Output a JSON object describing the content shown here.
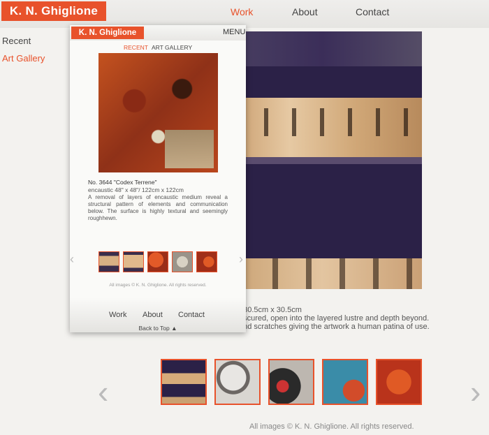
{
  "site": {
    "logo": "K. N. Ghiglione",
    "nav": [
      "Work",
      "About",
      "Contact"
    ]
  },
  "sidebar": {
    "items": [
      "Recent",
      "Art Gallery"
    ]
  },
  "main": {
    "size_text": "/ 30.5cm x 30.5cm",
    "desc_line1": "bscured, open into the layered lustre and depth beyond.",
    "desc_line2": "and scratches giving the artwork a human patina of use.",
    "thumb_count": 5,
    "prev_icon": "‹",
    "next_icon": "›",
    "copyright": "All images © K. N. Ghiglione. All rights reserved."
  },
  "mobile": {
    "logo": "K. N. Ghiglione",
    "menu": "MENU",
    "tab_recent": "RECENT",
    "tab_gallery": "ART GALLERY",
    "art_title": "No. 3644 \"Codex Terrene\"",
    "art_medium": "encaustic 48\" x 48\"/ 122cm x 122cm",
    "art_desc": "A removal of layers of encaustic medium reveal a structural pattern of elements and communication below. The surface is highly textural and seemingly roughhewn.",
    "prev_icon": "‹",
    "next_icon": "›",
    "copyright": "All images © K. N. Ghiglione. All rights reserved.",
    "footer_nav": [
      "Work",
      "About",
      "Contact"
    ],
    "back_to_top": "Back to Top ▲"
  },
  "colors": {
    "accent": "#e8522b",
    "background": "#f3f2ef"
  }
}
